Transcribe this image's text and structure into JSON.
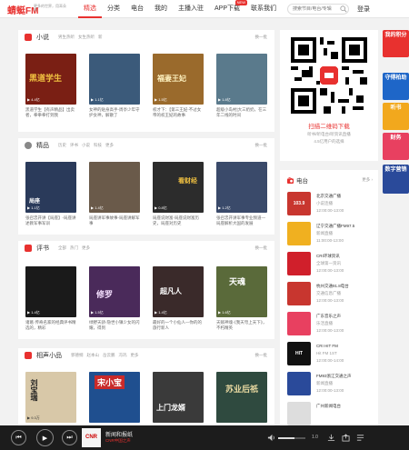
{
  "header": {
    "logo": "蜻蜓FM",
    "tagline_1": "更多的世界，用耳朵",
    "tagline_2": "听",
    "nav": [
      {
        "label": "精选",
        "active": true
      },
      {
        "label": "分类"
      },
      {
        "label": "电台"
      },
      {
        "label": "我的"
      },
      {
        "label": "主播入驻"
      },
      {
        "label": "APP下载",
        "badge": "NEW"
      },
      {
        "label": "联系我们"
      }
    ],
    "search_placeholder": "搜索节目/电台/专辑",
    "login": "登录"
  },
  "sections": [
    {
      "title": "小说",
      "icon_color": "#e8312f",
      "tags": [
        "男生热听",
        "女生热听",
        "新"
      ],
      "more": "换一批",
      "cards": [
        {
          "title": "黑道学生【有声精品】出卖者，拳拳拳打到我",
          "plays": "4.4亿",
          "art": "黑道学生",
          "bg": "#7a1f14"
        },
        {
          "title": "女神的贴身高手-周亭少年守护女神，解散了",
          "plays": "1.1亿",
          "art": "",
          "bg": "#3b5a7a"
        },
        {
          "title": "权才下：【第三王妃-不过女帝的权王妃的故事",
          "plays": "1.5亿",
          "art": "福妻王妃",
          "bg": "#9a6a2c"
        },
        {
          "title": "超级小岛村|大三奶奶，在三年二线的时间",
          "plays": "1.8亿",
          "art": "",
          "bg": "#5a7a8c"
        }
      ]
    },
    {
      "title": "精品",
      "icon_color": "#888888",
      "tags": [
        "历史",
        "评书",
        "小说",
        "科技",
        "更多"
      ],
      "more": "换一批",
      "cards": [
        {
          "title": "张召忠开讲【局座】-局座讲述教军事军训",
          "plays": "1.1亿",
          "art": "局座",
          "bg": "#2a3a5a"
        },
        {
          "title": "局座讲军事故事-局座讲解军事",
          "plays": "1.4亿",
          "art": "",
          "bg": "#6a5a4a"
        },
        {
          "title": "局座说财富-局座说财富历史，局座对历史",
          "plays": "0.8亿",
          "art": "看财经",
          "bg": "#2c2c2c"
        },
        {
          "title": "张召忠开讲军事专业频道—局座解析大国的发展",
          "plays": "1.2亿",
          "art": "",
          "bg": "#3a4a6a"
        }
      ]
    },
    {
      "title": "评书",
      "icon_color": "#e8312f",
      "tags": [
        "全部",
        "热门",
        "更多"
      ],
      "more": "换一批",
      "cards": [
        {
          "title": "诸葛·传奇名家的经典评书精选的，精彩",
          "plays": "1.4亿",
          "art": "",
          "bg": "#1a1a1a"
        },
        {
          "title": "绿野天骄·隐世小镇少女的闪耀，得到",
          "plays": "1.5亿",
          "art": "修罗",
          "bg": "#4a2a5a"
        },
        {
          "title": "最好的一个小仙人—你的的旅行新人",
          "plays": "1.4亿",
          "art": "超凡人",
          "bg": "#3a2a2a"
        },
        {
          "title": "天赋神魂·《我天穹上天下》，不朽精英",
          "plays": "1.6亿",
          "art": "天魂",
          "bg": "#5a6a3a"
        }
      ]
    },
    {
      "title": "相声小品",
      "icon_color": "#e8312f",
      "tags": [
        "郭德纲",
        "赵本山",
        "岳云鹏",
        "冯巩",
        "更多"
      ],
      "more": "换一批",
      "cards": [
        {
          "title": "",
          "plays": "9.3万",
          "art": "刘宝瑞",
          "bg": "#d8c8a8"
        },
        {
          "title": "",
          "plays": "",
          "art": "宋小宝",
          "bg": "#1f4f8f"
        },
        {
          "title": "",
          "plays": "",
          "art": "上门龙婿",
          "bg": "#3a3a3a"
        },
        {
          "title": "",
          "plays": "",
          "art": "苏业后祇",
          "bg": "#2f4a3f"
        }
      ]
    }
  ],
  "qr": {
    "title": "扫描二维码下载",
    "sub_1": "听书/听电台/听资讯直播",
    "sub_2": "4.5亿用户的选择"
  },
  "radio": {
    "title": "电台",
    "more": "更多",
    "items": [
      {
        "name": "北京交通广播",
        "show": "小说连播",
        "time": "12:00:00-13:00",
        "logo": "103.9",
        "bg": "#c8362f"
      },
      {
        "name": "辽宁交通广播FM97.5",
        "show": "新闻直播",
        "time": "11:00:00-13:00",
        "logo": "",
        "bg": "#f0b020"
      },
      {
        "name": "CRI环球资讯",
        "show": "全球第一资讯",
        "time": "12:00:00-13:00",
        "logo": "",
        "bg": "#d01f2b"
      },
      {
        "name": "杭州交通91.8电台",
        "show": "交通信息广播",
        "time": "12:00:00-13:00",
        "logo": "",
        "bg": "#c8362f"
      },
      {
        "name": "广东音乐之声",
        "show": "乐活直播",
        "time": "12:00:00-13:00",
        "logo": "",
        "bg": "#e84060"
      },
      {
        "name": "CRI HIT FM",
        "show": "Hit FM 1ST",
        "time": "12:00:00-14:00",
        "logo": "HIT",
        "bg": "#111111"
      },
      {
        "name": "FM93浙江交通之声",
        "show": "新闻直播",
        "time": "12:00:00-13:00",
        "logo": "",
        "bg": "#2a4a9a"
      },
      {
        "name": "广州新闻电台",
        "show": "",
        "time": "",
        "logo": "",
        "bg": "#dddddd"
      }
    ]
  },
  "side_ads": [
    {
      "text": "我的积分",
      "bg": "#e8312f"
    },
    {
      "text": "守得柏助",
      "bg": "#1e66c8"
    },
    {
      "text": "听书",
      "bg": "#f2a81d"
    },
    {
      "text": "财务",
      "bg": "#e84060"
    },
    {
      "text": "数字营销",
      "bg": "#2a4a9a"
    }
  ],
  "player": {
    "now_title": "新闻和报纸",
    "now_sub": "CNR中国之声",
    "art": "CNR",
    "progress": 0.6,
    "zoom": "1.0"
  }
}
